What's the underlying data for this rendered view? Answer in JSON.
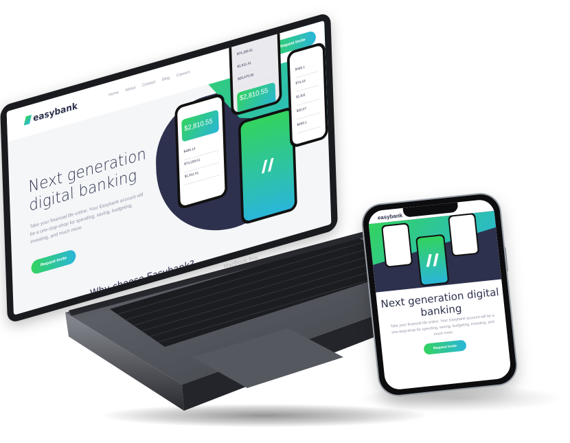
{
  "laptop": {
    "model_label": "MacBook Pro",
    "site": {
      "logo": "easybank",
      "nav": [
        "Home",
        "About",
        "Contact",
        "Blog",
        "Careers"
      ],
      "cta_header": "Request Invite",
      "hero_title": "Next generation digital banking",
      "hero_copy": "Take your financial life online. Your Easybank account will be a one-stop-shop for spending, saving, budgeting, investing, and much more.",
      "hero_cta": "Request Invite",
      "section_title_partial": "Why choose Easybank?",
      "mock_phone_card_value": "$2,810.55",
      "mock_rows": [
        "$489.14",
        "$74,189.61",
        "$1,811.41"
      ],
      "mock_back_rows": [
        "$74,189.61",
        "$1,811.41",
        "$29,476.00"
      ],
      "mock_back_card_value": "$2,810.55",
      "mock_right_rows": [
        "$489.1",
        "$74,18",
        "$1,811",
        "$20,47",
        "$499.1"
      ]
    }
  },
  "phone": {
    "logo": "easybank",
    "hero_title": "Next generation digital banking",
    "hero_copy": "Take your financial life online. Your Easybank account will be a one-stop-shop for spending, saving, budgeting, investing, and much more.",
    "cta": "Request Invite"
  },
  "colors": {
    "navy": "#2d314d",
    "green": "#33d35e",
    "cyan": "#2ab6d9",
    "gray_text": "#9597a7"
  }
}
